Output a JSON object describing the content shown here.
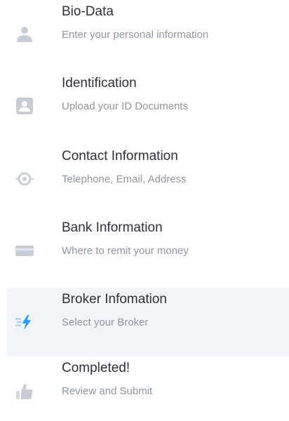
{
  "colors": {
    "icon_inactive": "#c8cdd3",
    "icon_active": "#2b9cff",
    "active_background": "#f1f4f8"
  },
  "steps": [
    {
      "title": "Bio-Data",
      "subtitle": "Enter your personal information",
      "icon": "person-icon",
      "active": false
    },
    {
      "title": "Identification",
      "subtitle": "Upload your ID Documents",
      "icon": "id-card-icon",
      "active": false
    },
    {
      "title": "Contact Information",
      "subtitle": "Telephone, Email, Address",
      "icon": "location-icon",
      "active": false
    },
    {
      "title": "Bank Information",
      "subtitle": "Where to remit your money",
      "icon": "credit-card-icon",
      "active": false
    },
    {
      "title": "Broker Infomation",
      "subtitle": "Select your Broker",
      "icon": "lightning-icon",
      "active": true
    },
    {
      "title": "Completed!",
      "subtitle": "Review and Submit",
      "icon": "thumbs-up-icon",
      "active": false
    }
  ]
}
